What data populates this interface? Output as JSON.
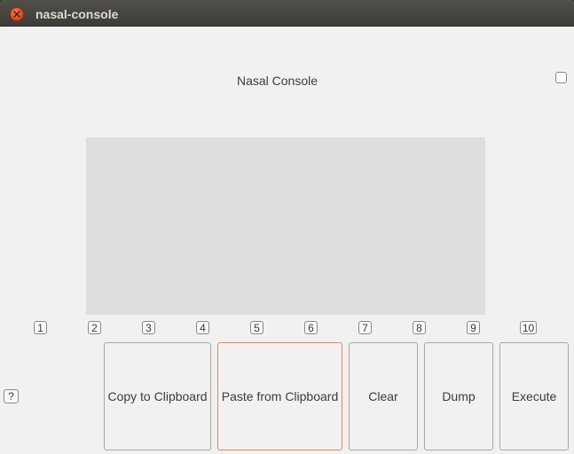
{
  "window": {
    "title": "nasal-console"
  },
  "main": {
    "heading": "Nasal Console",
    "column_numbers": [
      "1",
      "2",
      "3",
      "4",
      "5",
      "6",
      "7",
      "8",
      "9",
      "10"
    ],
    "help_label": "?"
  },
  "buttons": {
    "copy": "Copy to Clipboard",
    "paste": "Paste from Clipboard",
    "clear": "Clear",
    "dump": "Dump",
    "execute": "Execute"
  },
  "colors": {
    "titlebar": "#3d3c38",
    "close_button": "#df4a16",
    "focus_border": "#e2855d",
    "output_area": "#dedede"
  }
}
